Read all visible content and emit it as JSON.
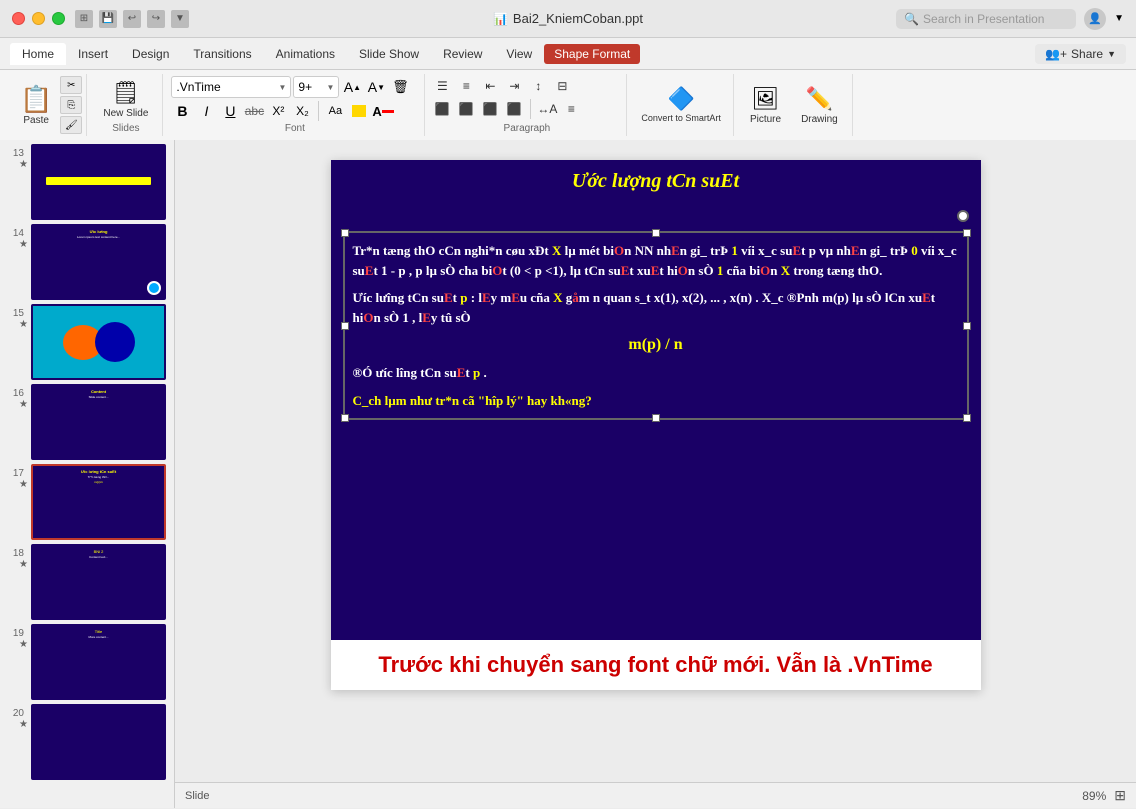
{
  "titleBar": {
    "title": "Bai2_KniemCoban.ppt",
    "searchPlaceholder": "Search in Presentation"
  },
  "ribbonTabs": {
    "tabs": [
      "Home",
      "Insert",
      "Design",
      "Transitions",
      "Animations",
      "Slide Show",
      "Review",
      "View",
      "Shape Format"
    ],
    "activeTab": "Home",
    "shapeFormatTab": "Shape Format",
    "shareLabel": "Share"
  },
  "toolbar": {
    "pasteLabel": "Paste",
    "newSlideLabel": "New Slide",
    "fontName": ".VnTime",
    "fontSize": "9+",
    "boldLabel": "B",
    "italicLabel": "I",
    "underlineLabel": "U",
    "strikeLabel": "abc",
    "superLabel": "X²",
    "subLabel": "X₂",
    "fontColorLabel": "A",
    "convertSmartArtLabel": "Convert to SmartArt",
    "pictureLabel": "Picture",
    "drawingLabel": "Drawing",
    "alignLeft": "≡",
    "alignCenter": "≡",
    "alignRight": "≡",
    "justify": "≡",
    "lineSpacing": "≡",
    "columns": "≡",
    "textDirection": "A",
    "alignText": "≡"
  },
  "slidePanel": {
    "slides": [
      {
        "num": "13",
        "hasContent": true
      },
      {
        "num": "14",
        "hasContent": true
      },
      {
        "num": "15",
        "hasContent": true
      },
      {
        "num": "16",
        "hasContent": true
      },
      {
        "num": "17",
        "hasContent": true,
        "active": true
      },
      {
        "num": "18",
        "hasContent": true
      },
      {
        "num": "19",
        "hasContent": true
      },
      {
        "num": "20",
        "hasContent": true
      }
    ]
  },
  "slideContent": {
    "title": "Ước lượng tCn suEt",
    "paragraphs": [
      "Tr*n tæng thO cCn nghi*n cøu xÐt X  lµ mét biOn NN nhEn gi_ trÞ  1  víi x_c suEt p  vµ nhEn gi_ trÞ  0  víi x_c suEt  1 - p ,  p  lµ sÒ cha biOt (0 < p <1), lµ tCn suEt xuEt hiOn sÒ 1 cña biOn  X  trong tæng thO.",
      "Ưíc lưîng tCn suEt  p : lEy mEu cña  X  gåm  n  quan s_t  x(1), x(2), ... , x(n) . X_c ®Pnh   m(p)  lµ sÒ lCn xuEt hiOn sÒ  1 , lEy tû sÒ",
      "m(p) / n",
      "®Ó ưíc lîng tCn suEt  p .",
      "C_ch lµm như tr*n cã \"hîp lý\" hay kh«ng?"
    ],
    "caption": "Trước khi chuyển sang font chữ mới. Vẫn là .VnTime"
  },
  "statusBar": {
    "slideLabel": "Slide",
    "zoomLevel": "89%"
  },
  "colors": {
    "slideBackground": "#1a0066",
    "titleColor": "#ffff00",
    "bodyTextColor": "#ffffff",
    "redText": "#ff4444",
    "yellowText": "#ffff00",
    "captionColor": "#cc0000",
    "accentRed": "#c0392b",
    "ribbonBackground": "#f5f5f5"
  }
}
